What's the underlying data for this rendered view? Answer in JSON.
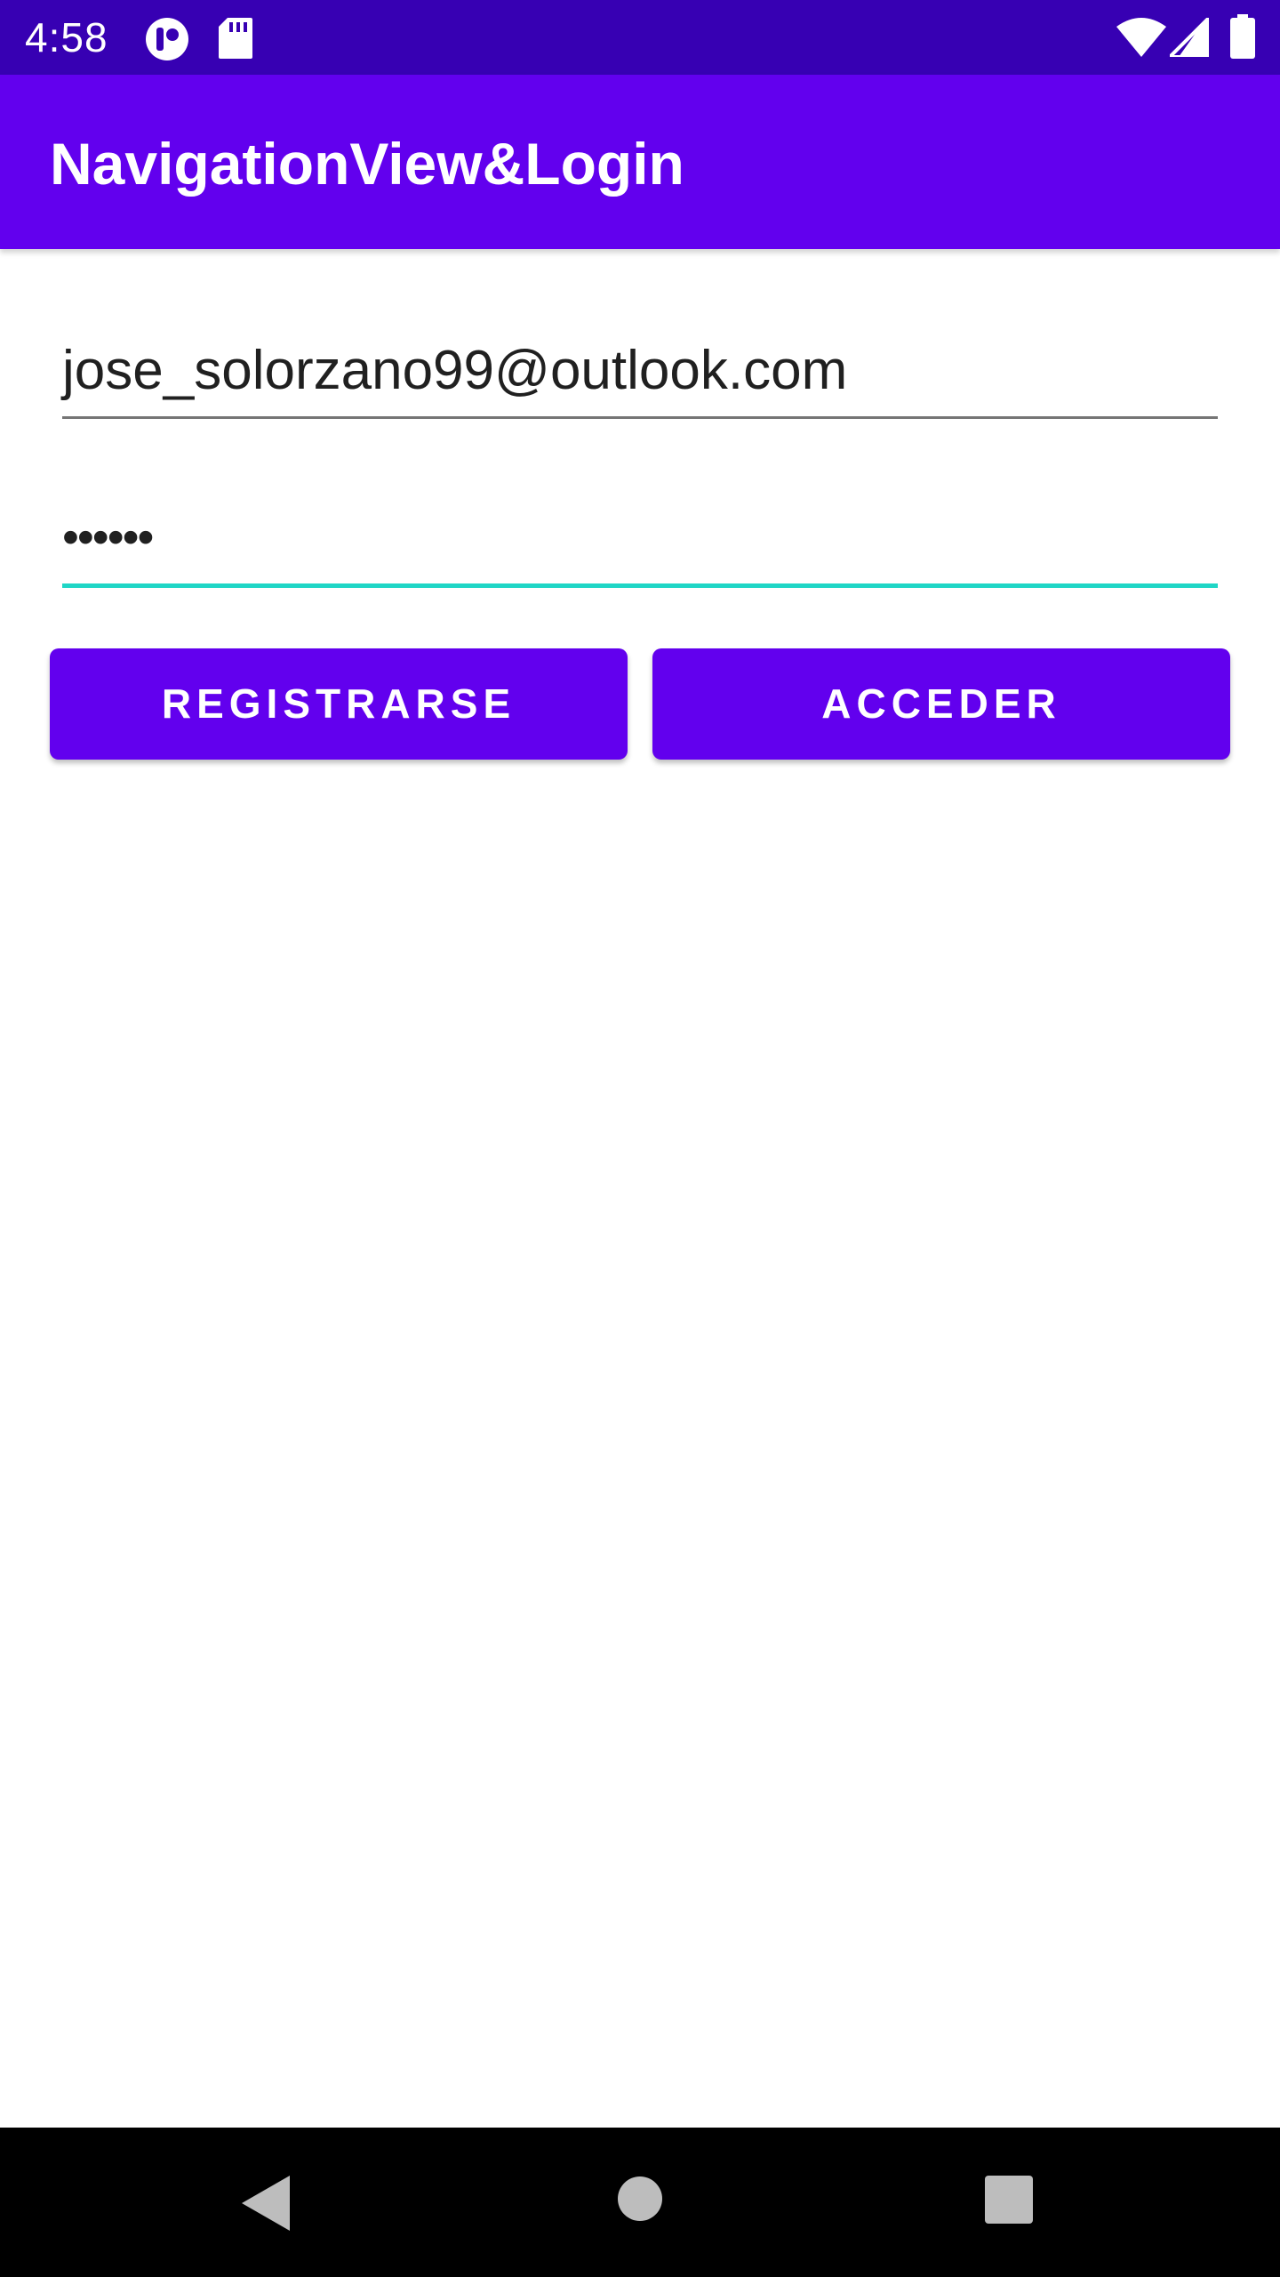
{
  "status_bar": {
    "time": "4:58",
    "icons": [
      "notification-app-icon",
      "sd-card-icon",
      "wifi-icon",
      "cell-signal-icon",
      "battery-icon"
    ]
  },
  "app_bar": {
    "title": "NavigationView&Login",
    "color": "#6200ee"
  },
  "login_form": {
    "email_value": "jose_solorzano99@outlook.com",
    "password_value": "••••••",
    "accent_color": "#1fd6c6"
  },
  "buttons": {
    "register_label": "REGISTRARSE",
    "login_label": "ACCEDER",
    "color": "#6200ee"
  },
  "nav_bar": {
    "icons": [
      "back-icon",
      "home-icon",
      "recents-icon"
    ]
  }
}
